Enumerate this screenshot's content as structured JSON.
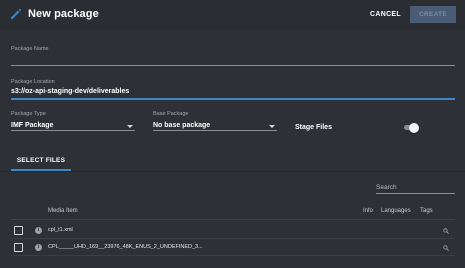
{
  "header": {
    "title": "New package",
    "cancel_label": "CANCEL",
    "create_label": "CREATE"
  },
  "form": {
    "package_name": {
      "label": "Package Name",
      "value": ""
    },
    "package_location": {
      "label": "Package Location",
      "value": "s3://oz-api-staging-dev/deliverables"
    },
    "package_type": {
      "label": "Package Type",
      "value": "IMF Package"
    },
    "base_package": {
      "label": "Base Package",
      "value": "No base package"
    },
    "stage_files": {
      "label": "Stage Files",
      "enabled": false
    }
  },
  "tabs": [
    {
      "label": "SELECT FILES",
      "active": true
    }
  ],
  "search": {
    "placeholder": "Search"
  },
  "table": {
    "columns": {
      "media": "Media Item",
      "info": "Info",
      "languages": "Languages",
      "tags": "Tags"
    },
    "rows": [
      {
        "name": "cpl_t1.xml"
      },
      {
        "name": "CPL_____UHD_169__23976_48K_ENUS_2_UNDEFINED_3..."
      }
    ]
  },
  "colors": {
    "accent": "#3d86c9",
    "background": "#2d3035",
    "create_button": "#4a5c75"
  },
  "icons": {
    "edit": "pencil-icon",
    "info": "info-icon",
    "row_action": "search-icon"
  }
}
